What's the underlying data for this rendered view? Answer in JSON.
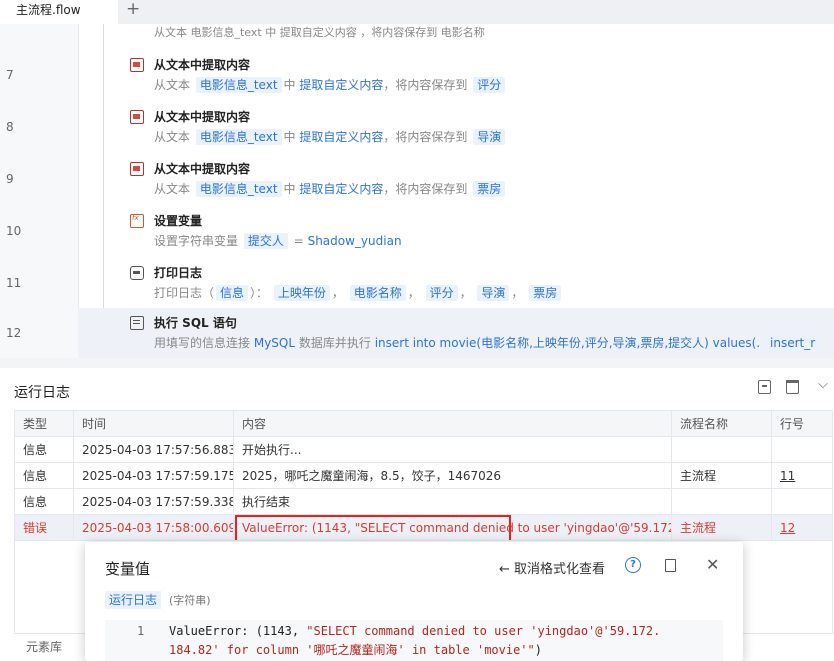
{
  "tabs": {
    "active": "主流程.flow",
    "add": "+"
  },
  "steps": [
    {
      "no": "",
      "title": "",
      "desc_partial": "从文本 电影信息_text 中 提取自定义内容 ，将内容保存到 电影名称"
    },
    {
      "no": "7",
      "title": "从文本中提取内容",
      "from": "从文本",
      "src": "电影信息_text",
      "in": "中",
      "op": "提取自定义内容",
      "save": "，将内容保存到",
      "target": "评分"
    },
    {
      "no": "8",
      "title": "从文本中提取内容",
      "from": "从文本",
      "src": "电影信息_text",
      "in": "中",
      "op": "提取自定义内容",
      "save": "，将内容保存到",
      "target": "导演"
    },
    {
      "no": "9",
      "title": "从文本中提取内容",
      "from": "从文本",
      "src": "电影信息_text",
      "in": "中",
      "op": "提取自定义内容",
      "save": "，将内容保存到",
      "target": "票房"
    },
    {
      "no": "10",
      "title": "设置变量",
      "desc": "设置字符串变量",
      "var": "提交人",
      "eq": "=",
      "value": "Shadow_yudian"
    },
    {
      "no": "11",
      "title": "打印日志",
      "desc": "打印日志（",
      "level": "信息",
      "close": "）：",
      "items": [
        "上映年份",
        "电影名称",
        "评分",
        "导演",
        "票房"
      ]
    },
    {
      "no": "12",
      "title": "执行 SQL 语句",
      "desc": "用填写的信息连接",
      "db": "MySQL",
      "mid": "数据库并执行",
      "sql": "insert into movie(电影名称,上映年份,评分,导演,票房,提交人) values(.",
      "result": "insert_r"
    }
  ],
  "log": {
    "title": "运行日志",
    "headers": [
      "类型",
      "时间",
      "内容",
      "流程名称",
      "行号"
    ],
    "rows": [
      {
        "type": "信息",
        "time": "2025-04-03 17:57:56.883",
        "content": "开始执行...",
        "flow": "",
        "line": ""
      },
      {
        "type": "信息",
        "time": "2025-04-03 17:57:59.175",
        "content": "2025，哪吒之魔童闹海，8.5，饺子，1467026",
        "flow": "主流程",
        "line": "11"
      },
      {
        "type": "信息",
        "time": "2025-04-03 17:57:59.338",
        "content": "执行结束",
        "flow": "",
        "line": ""
      },
      {
        "type": "错误",
        "time": "2025-04-03 17:58:00.609",
        "content": "ValueError: (1143, \"SELECT command denied to user 'yingdao'@'59.172...",
        "flow": "主流程",
        "line": "12"
      }
    ]
  },
  "bottom_tab": "元素库",
  "popup": {
    "title": "变量值",
    "back": "← 取消格式化查看",
    "help": "?",
    "chip": "运行日志",
    "type": "(字符串)",
    "line_no": "1",
    "code_plain": "ValueError: (1143, ",
    "code_str1": "\"SELECT command denied to user 'yingdao'@'59.172.",
    "code_str2": "184.82' for column '哪吒之魔童闹海' in table 'movie'\"",
    "code_end": ")"
  }
}
